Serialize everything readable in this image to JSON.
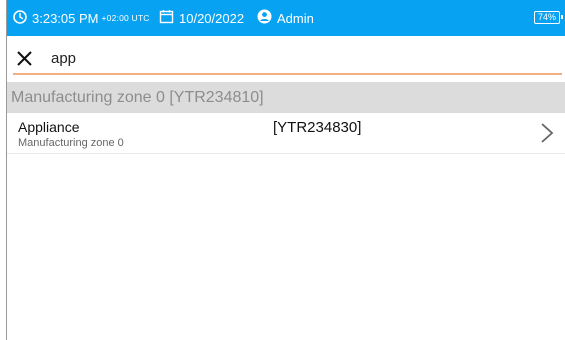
{
  "status_bar": {
    "time": "3:23:05 PM",
    "timezone": "+02:00 UTC",
    "date": "10/20/2022",
    "user": "Admin",
    "battery": "74%",
    "background_color": "#08a2f3",
    "icons": [
      "clock-icon",
      "calendar-icon",
      "user-icon",
      "battery-icon"
    ]
  },
  "search": {
    "value": "app",
    "close_icon": "close-icon",
    "underline_color": "#f2b082"
  },
  "zone_header": {
    "label": "Manufacturing zone 0 [YTR234810]"
  },
  "results": [
    {
      "name": "Appliance",
      "zone": "Manufacturing zone 0",
      "code": "[YTR234830]",
      "icon": "chevron-right-icon"
    }
  ]
}
